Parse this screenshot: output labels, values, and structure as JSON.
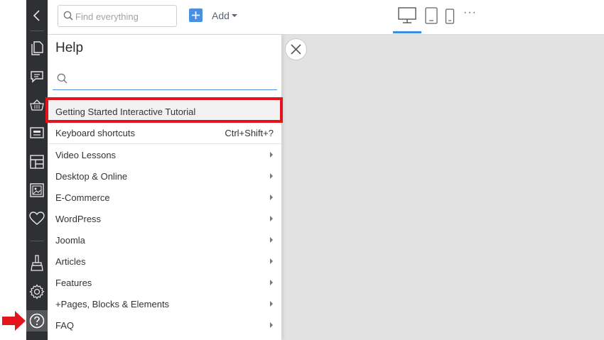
{
  "topbar": {
    "search_placeholder": "Find everything",
    "add_label": "Add"
  },
  "help": {
    "title": "Help",
    "search_placeholder": "",
    "items": [
      {
        "label": "Getting Started Interactive Tutorial",
        "right": ""
      },
      {
        "label": "Keyboard shortcuts",
        "right": "Ctrl+Shift+?"
      },
      {
        "label": "Video Lessons",
        "right": ""
      },
      {
        "label": "Desktop & Online",
        "right": ""
      },
      {
        "label": "E-Commerce",
        "right": ""
      },
      {
        "label": "WordPress",
        "right": ""
      },
      {
        "label": "Joomla",
        "right": ""
      },
      {
        "label": "Articles",
        "right": ""
      },
      {
        "label": "Features",
        "right": ""
      },
      {
        "label": "+Pages, Blocks & Elements",
        "right": ""
      },
      {
        "label": "FAQ",
        "right": ""
      }
    ]
  },
  "sidebar_icons": [
    "back-icon",
    "pages-icon",
    "comment-icon",
    "basket-icon",
    "block-icon",
    "layout-icon",
    "image-icon",
    "heart-icon",
    "brush-icon",
    "gear-icon",
    "help-icon"
  ],
  "colors": {
    "accent": "#4a90e2",
    "highlight_red": "#e3141b",
    "sidebar": "#2f3033"
  }
}
